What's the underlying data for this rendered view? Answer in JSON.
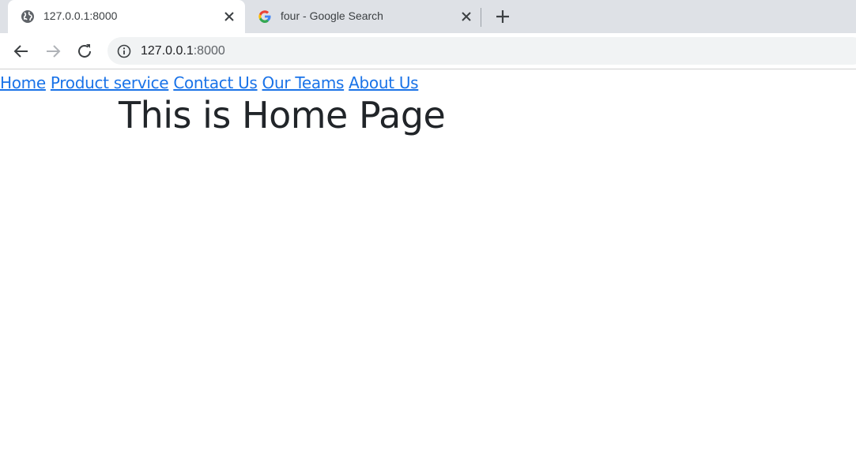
{
  "browser": {
    "tabs": [
      {
        "title": "127.0.0.1:8000",
        "icon": "globe-icon",
        "active": true
      },
      {
        "title": "four - Google Search",
        "icon": "google-icon",
        "active": false
      }
    ],
    "address": {
      "host": "127.0.0.1",
      "port": ":8000"
    }
  },
  "page": {
    "nav": [
      "Home",
      "Product service",
      "Contact Us",
      "Our Teams",
      "About Us"
    ],
    "heading": "This is Home Page"
  },
  "colors": {
    "link": "#1a73e8",
    "heading": "#212529",
    "tabstrip": "#dee1e6"
  }
}
